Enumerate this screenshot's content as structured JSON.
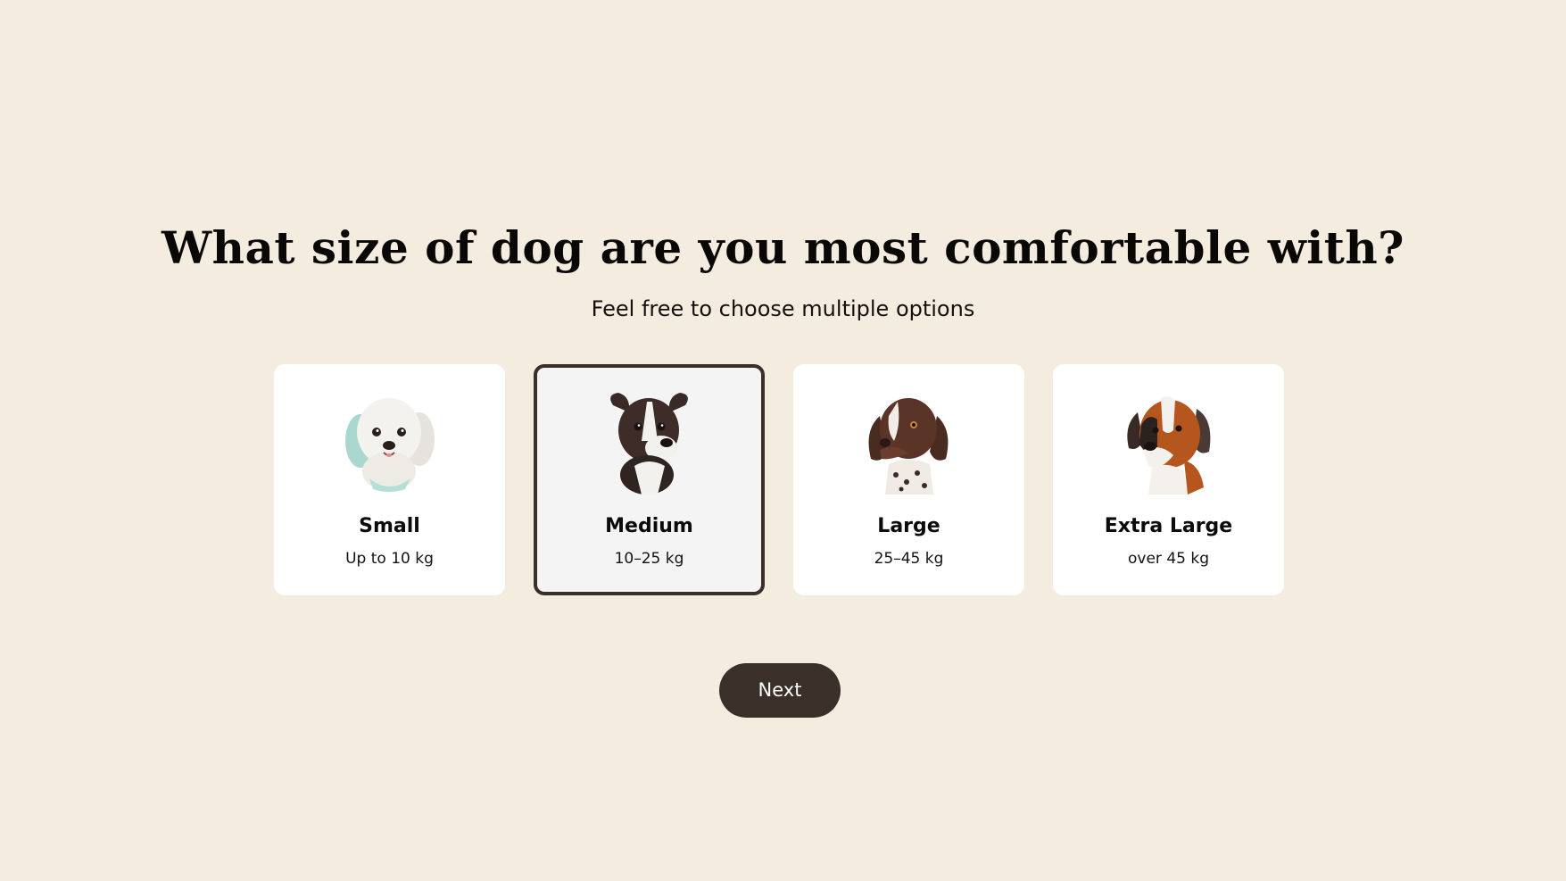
{
  "header": {
    "title": "What size of dog are you most comfortable with?",
    "subtitle": "Feel free to choose multiple options"
  },
  "options": [
    {
      "label": "Small",
      "range": "Up to 10 kg",
      "selected": false,
      "icon": "small-dog-icon"
    },
    {
      "label": "Medium",
      "range": "10–25 kg",
      "selected": true,
      "icon": "medium-dog-icon"
    },
    {
      "label": "Large",
      "range": "25–45 kg",
      "selected": false,
      "icon": "large-dog-icon"
    },
    {
      "label": "Extra Large",
      "range": "over 45 kg",
      "selected": false,
      "icon": "extra-large-dog-icon"
    }
  ],
  "actions": {
    "next_label": "Next"
  },
  "colors": {
    "background": "#f5ece0",
    "card": "#ffffff",
    "selected_card": "#f4f4f4",
    "accent": "#3a2f29",
    "text": "#0d0b0a"
  }
}
